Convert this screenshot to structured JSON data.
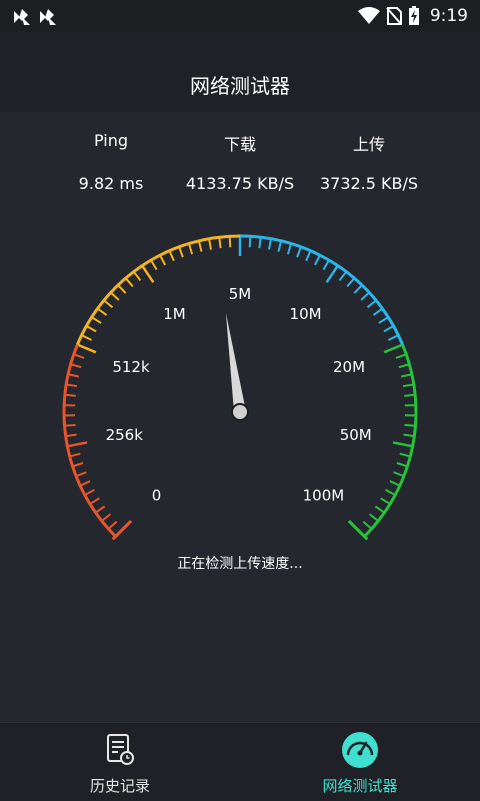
{
  "status_bar": {
    "time": "9:19",
    "icons": [
      "app-notification-icon",
      "app-notification-icon",
      "wifi-icon",
      "no-sim-icon",
      "battery-charging-icon"
    ]
  },
  "header": {
    "title": "网络测试器"
  },
  "stats": {
    "ping": {
      "label": "Ping",
      "value": "9.82 ms"
    },
    "download": {
      "label": "下载",
      "value": "4133.75 KB/S"
    },
    "upload": {
      "label": "上传",
      "value": "3732.5 KB/S"
    }
  },
  "gauge": {
    "scale_labels": [
      "0",
      "256k",
      "512k",
      "1M",
      "5M",
      "10M",
      "20M",
      "50M",
      "100M"
    ],
    "needle_value_fraction": 0.47,
    "colors": {
      "orange": "#e8552a",
      "yellow": "#f2b51f",
      "blue": "#2ab6e8",
      "green": "#27c23a"
    }
  },
  "status_message": "正在检测上传速度...",
  "bottom_nav": {
    "items": [
      {
        "label": "历史记录",
        "icon": "history-document-icon",
        "active": false
      },
      {
        "label": "网络测试器",
        "icon": "speedometer-icon",
        "active": true
      }
    ],
    "active_color": "#3fe0d0"
  }
}
